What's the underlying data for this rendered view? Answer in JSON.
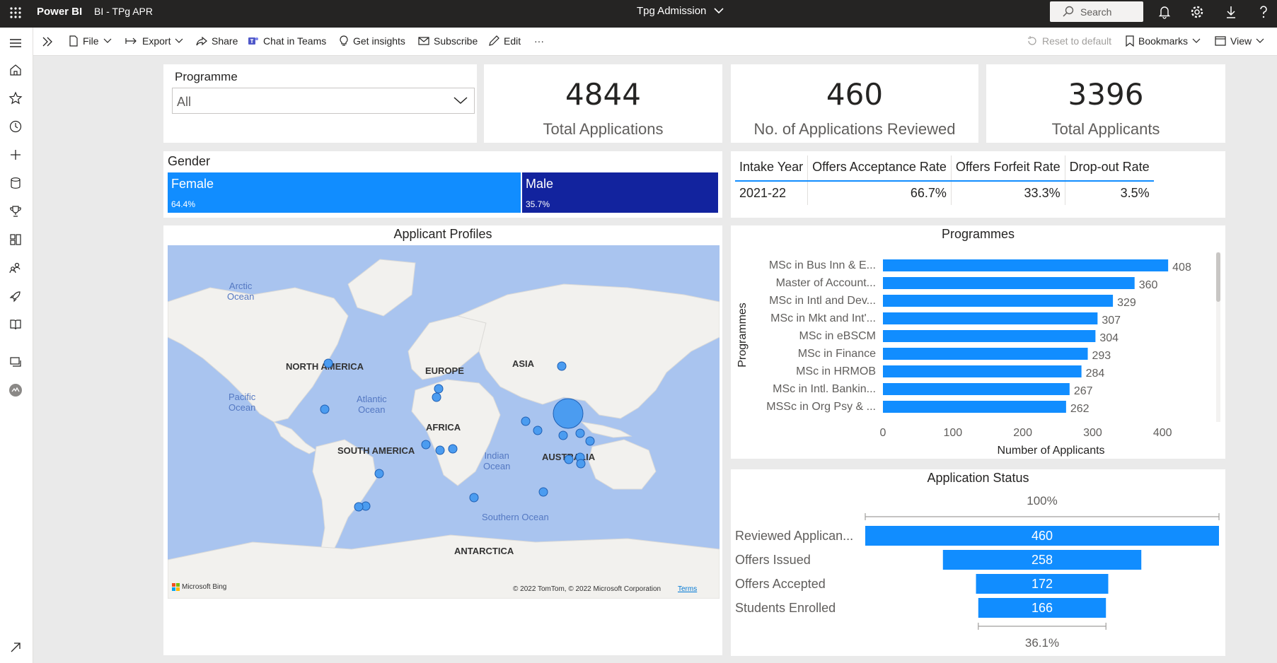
{
  "topbar": {
    "brand": "Power BI",
    "workspace": "BI - TPg APR",
    "report_name": "Tpg Admission",
    "search_placeholder": "Search"
  },
  "actionbar": {
    "file": "File",
    "export": "Export",
    "share": "Share",
    "chat": "Chat in Teams",
    "insights": "Get insights",
    "subscribe": "Subscribe",
    "edit": "Edit",
    "more": "···",
    "reset": "Reset to default",
    "bookmarks": "Bookmarks",
    "view": "View"
  },
  "slicer": {
    "title": "Programme",
    "value": "All"
  },
  "kpis": [
    {
      "value": "4844",
      "label": "Total Applications"
    },
    {
      "value": "460",
      "label": "No. of Applications Reviewed"
    },
    {
      "value": "3396",
      "label": "Total Applicants"
    }
  ],
  "gender": {
    "title": "Gender",
    "segments": [
      {
        "label": "Female",
        "pct_text": "64.4%",
        "share": 64.4,
        "color": "#118dff"
      },
      {
        "label": "Male",
        "pct_text": "35.7%",
        "share": 35.7,
        "color": "#12239e"
      }
    ]
  },
  "rates": {
    "headers": [
      "Intake Year",
      "Offers Acceptance Rate",
      "Offers Forfeit Rate",
      "Drop-out Rate"
    ],
    "row": [
      "2021-22",
      "66.7%",
      "33.3%",
      "3.5%"
    ]
  },
  "map": {
    "title": "Applicant Profiles",
    "continents": [
      "NORTH AMERICA",
      "EUROPE",
      "ASIA",
      "AFRICA",
      "SOUTH AMERICA",
      "AUSTRALIA",
      "ANTARCTICA"
    ],
    "oceans": [
      "Arctic\nOcean",
      "Pacific\nOcean",
      "Atlantic\nOcean",
      "Indian\nOcean",
      "Southern Ocean"
    ],
    "bing": "Microsoft Bing",
    "copyright": "© 2022 TomTom, © 2022 Microsoft Corporation",
    "terms": "Terms"
  },
  "chart_data": [
    {
      "type": "bar",
      "orientation": "horizontal",
      "title": "Programmes",
      "ylabel": "Programmes",
      "xlabel": "Number of Applicants",
      "categories": [
        "MSc in Bus Inn & E...",
        "Master of Account...",
        "MSc in Intl and Dev...",
        "MSc in Mkt and Int'...",
        "MSc in eBSCM",
        "MSc in Finance",
        "MSc in HRMOB",
        "MSc in Intl. Bankin...",
        "MSSc in Org Psy & ..."
      ],
      "values": [
        408,
        360,
        329,
        307,
        304,
        293,
        284,
        267,
        262
      ],
      "xlim": [
        0,
        420
      ],
      "xticks": [
        0,
        100,
        200,
        300,
        400
      ],
      "color": "#118dff"
    },
    {
      "type": "funnel",
      "title": "Application Status",
      "categories": [
        "Reviewed Applican...",
        "Offers Issued",
        "Offers Accepted",
        "Students Enrolled"
      ],
      "values": [
        460,
        258,
        172,
        166
      ],
      "top_label": "100%",
      "bottom_label": "36.1%",
      "color": "#118dff"
    }
  ]
}
